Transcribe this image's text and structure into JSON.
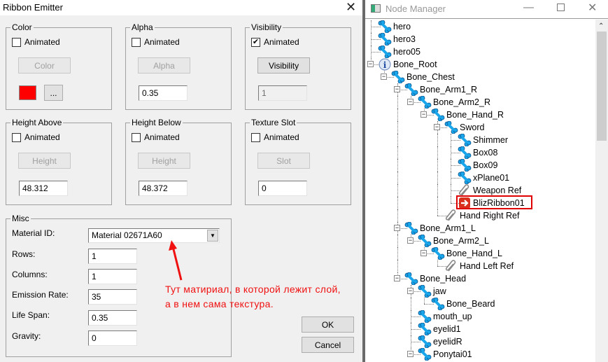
{
  "dialog": {
    "title": "Ribbon Emitter",
    "close_icon": "close-icon",
    "groups": {
      "color": {
        "label": "Color",
        "animated_label": "Animated",
        "animated": false,
        "button": "Color",
        "swatch_color": "#ff0000",
        "picker_button": "..."
      },
      "alpha": {
        "label": "Alpha",
        "animated_label": "Animated",
        "animated": false,
        "button": "Alpha",
        "value": "0.35"
      },
      "visibility": {
        "label": "Visibility",
        "animated_label": "Animated",
        "animated": true,
        "button": "Visibility",
        "value": "1"
      },
      "height_above": {
        "label": "Height Above",
        "animated_label": "Animated",
        "animated": false,
        "button": "Height",
        "value": "48.312"
      },
      "height_below": {
        "label": "Height Below",
        "animated_label": "Animated",
        "animated": false,
        "button": "Height",
        "value": "48.372"
      },
      "texture_slot": {
        "label": "Texture Slot",
        "animated_label": "Animated",
        "animated": false,
        "button": "Slot",
        "value": "0"
      }
    },
    "misc": {
      "label": "Misc",
      "material_label": "Material ID:",
      "material_value": "Material 02671A60",
      "rows_label": "Rows:",
      "rows": "1",
      "columns_label": "Columns:",
      "columns": "1",
      "emission_label": "Emission Rate:",
      "emission": "35",
      "lifespan_label": "Life Span:",
      "lifespan": "0.35",
      "gravity_label": "Gravity:",
      "gravity": "0"
    },
    "ok": "OK",
    "cancel": "Cancel",
    "annotation": {
      "line1": "Тут матириал, в которой лежит слой,",
      "line2": "а в нем сама текстура.",
      "color": "#f01010"
    }
  },
  "node_manager": {
    "title": "Node Manager",
    "highlight_color": "#e00000",
    "nodes": [
      {
        "label": "hero",
        "depth": 0,
        "icon": "bone"
      },
      {
        "label": "hero3",
        "depth": 0,
        "icon": "bone"
      },
      {
        "label": "hero05",
        "depth": 0,
        "icon": "bone"
      },
      {
        "label": "Bone_Root",
        "depth": 0,
        "icon": "info",
        "expanded": true
      },
      {
        "label": "Bone_Chest",
        "depth": 1,
        "icon": "bone",
        "expanded": true
      },
      {
        "label": "Bone_Arm1_R",
        "depth": 2,
        "icon": "bone",
        "expanded": true
      },
      {
        "label": "Bone_Arm2_R",
        "depth": 3,
        "icon": "bone",
        "expanded": true
      },
      {
        "label": "Bone_Hand_R",
        "depth": 4,
        "icon": "bone",
        "expanded": true
      },
      {
        "label": "Sword",
        "depth": 5,
        "icon": "bone",
        "expanded": true
      },
      {
        "label": "Shimmer",
        "depth": 6,
        "icon": "bone"
      },
      {
        "label": "Box08",
        "depth": 6,
        "icon": "bone"
      },
      {
        "label": "Box09",
        "depth": 6,
        "icon": "bone"
      },
      {
        "label": "xPlane01",
        "depth": 6,
        "icon": "bone"
      },
      {
        "label": "Weapon Ref",
        "depth": 6,
        "icon": "clip"
      },
      {
        "label": "BlizRibbon01",
        "depth": 6,
        "icon": "ribbon",
        "highlighted": true
      },
      {
        "label": "Hand Right Ref",
        "depth": 5,
        "icon": "clip"
      },
      {
        "label": "Bone_Arm1_L",
        "depth": 2,
        "icon": "bone",
        "expanded": true
      },
      {
        "label": "Bone_Arm2_L",
        "depth": 3,
        "icon": "bone",
        "expanded": true
      },
      {
        "label": "Bone_Hand_L",
        "depth": 4,
        "icon": "bone",
        "expanded": true
      },
      {
        "label": "Hand Left Ref",
        "depth": 5,
        "icon": "clip"
      },
      {
        "label": "Bone_Head",
        "depth": 2,
        "icon": "bone",
        "expanded": true
      },
      {
        "label": "jaw",
        "depth": 3,
        "icon": "bone",
        "expanded": true
      },
      {
        "label": "Bone_Beard",
        "depth": 4,
        "icon": "bone"
      },
      {
        "label": "mouth_up",
        "depth": 3,
        "icon": "bone"
      },
      {
        "label": "eyelid1",
        "depth": 3,
        "icon": "bone"
      },
      {
        "label": "eyelidR",
        "depth": 3,
        "icon": "bone"
      },
      {
        "label": "Ponytai01",
        "depth": 3,
        "icon": "bone",
        "expanded": true
      }
    ]
  }
}
